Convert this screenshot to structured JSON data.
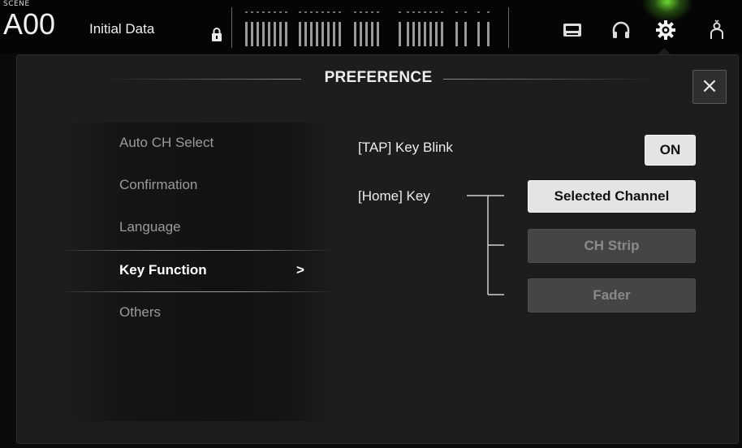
{
  "header": {
    "scene_label": "SCENE",
    "scene_number": "A00",
    "scene_name": "Initial Data"
  },
  "icons": {
    "lock": "lock-icon",
    "recorder": "cassette-icon",
    "monitor": "headphones-icon",
    "setup": "gear-icon",
    "user": "user-icon"
  },
  "panel": {
    "title": "PREFERENCE",
    "close_label": "×"
  },
  "menu": {
    "items": [
      {
        "label": "Auto CH Select"
      },
      {
        "label": "Confirmation"
      },
      {
        "label": "Language"
      },
      {
        "label": "Key Function",
        "arrow": ">"
      },
      {
        "label": "Others"
      }
    ]
  },
  "settings": {
    "tap_key_blink": {
      "label": "[TAP] Key Blink",
      "value": "ON"
    },
    "home_key": {
      "label": "[Home] Key",
      "options": [
        "Selected Channel",
        "CH Strip",
        "Fader"
      ],
      "selected": "Selected Channel"
    }
  },
  "colors": {
    "accent_glow": "#82ff3c",
    "button_on": "#e4e4e4",
    "button_off": "#454545",
    "panel_bg": "#1d1d1d"
  }
}
